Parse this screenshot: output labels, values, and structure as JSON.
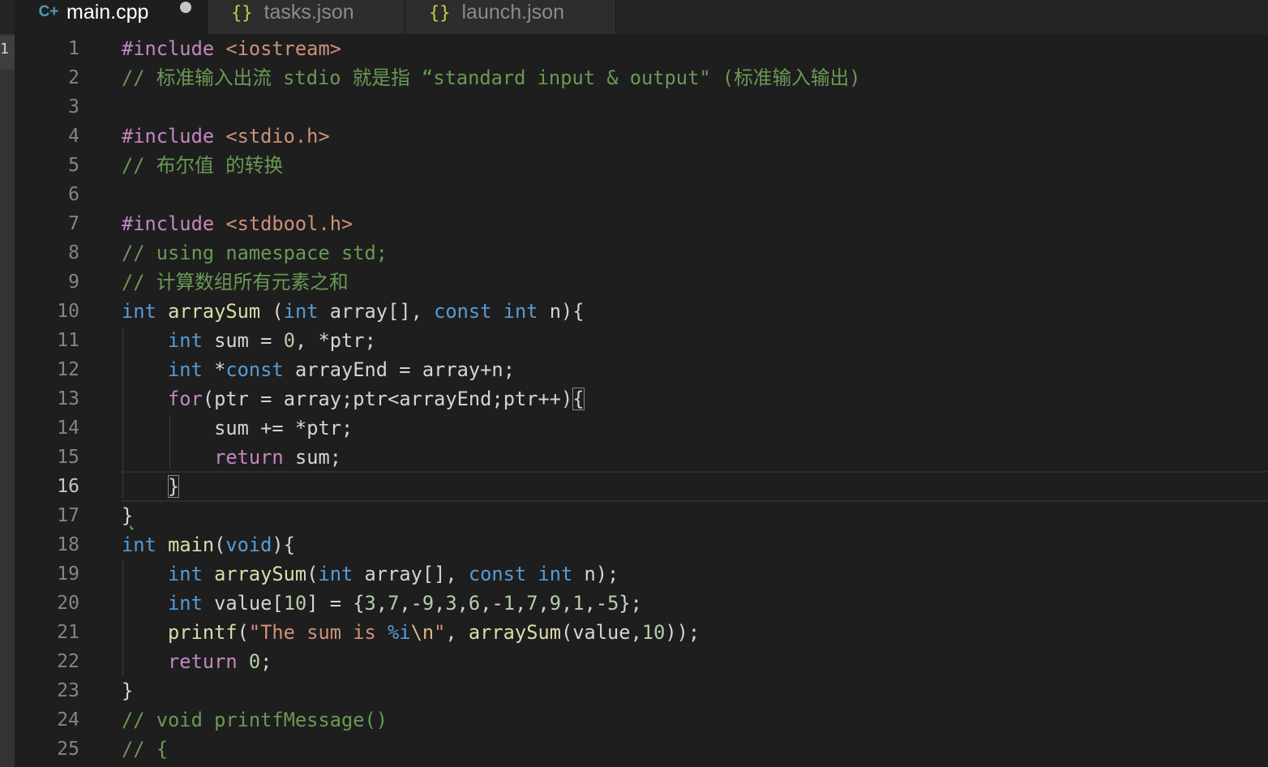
{
  "tabs": [
    {
      "icon": "cpp-file-icon",
      "icon_glyph": "C+",
      "label": "main.cpp",
      "active": true,
      "dirty": true
    },
    {
      "icon": "json-file-icon",
      "icon_glyph": "{}",
      "label": "tasks.json",
      "active": false
    },
    {
      "icon": "json-file-icon",
      "icon_glyph": "{}",
      "label": "launch.json",
      "active": false
    }
  ],
  "editor": {
    "current_line": 16,
    "line_numbers": [
      "1",
      "2",
      "3",
      "4",
      "5",
      "6",
      "7",
      "8",
      "9",
      "10",
      "11",
      "12",
      "13",
      "14",
      "15",
      "16",
      "17",
      "18",
      "19",
      "20",
      "21",
      "22",
      "23",
      "24",
      "25"
    ],
    "lines": [
      "#include <iostream>",
      "// 标准输入出流 stdio 就是指 “standard input & output\" (标准输入输出)",
      "",
      "#include <stdio.h>",
      "// 布尔值 的转换",
      "",
      "#include <stdbool.h>",
      "// using namespace std;",
      "// 计算数组所有元素之和",
      "int arraySum (int array[], const int n){",
      "    int sum = 0, *ptr;",
      "    int *const arrayEnd = array+n;",
      "    for(ptr = array;ptr<arrayEnd;ptr++){",
      "        sum += *ptr;",
      "        return sum;",
      "    }",
      "}",
      "int main(void){",
      "    int arraySum(int array[], const int n);",
      "    int value[10] = {3,7,-9,3,6,-1,7,9,1,-5};",
      "    printf(\"The sum is %i\\n\", arraySum(value,10));",
      "    return 0;",
      "}",
      "// void printfMessage()",
      "// {"
    ]
  },
  "colors": {
    "background": "#1e1e1e",
    "keyword": "#569cd6",
    "comment": "#6a9955",
    "control": "#c586c0",
    "string": "#ce9178",
    "function": "#dcdcaa",
    "number": "#b5cea8"
  },
  "left_marker": "1"
}
